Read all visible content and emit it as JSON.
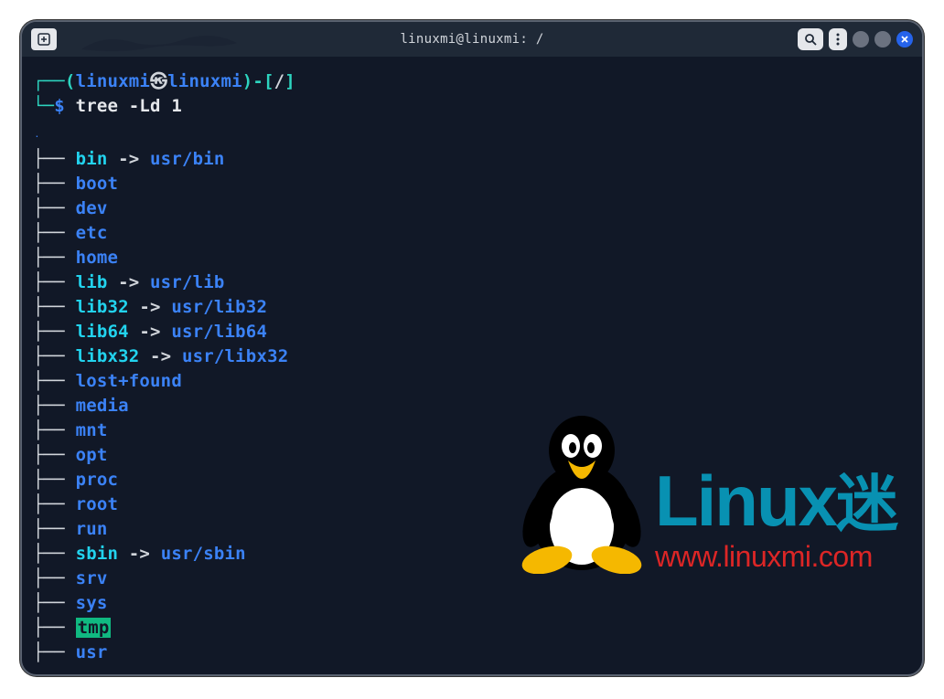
{
  "titlebar": {
    "title": "linuxmi@linuxmi: /",
    "tab_icon": "＋",
    "search_icon": "search",
    "menu_icon": "menu"
  },
  "prompt": {
    "corner_top": "┌──",
    "paren_open": "(",
    "user": "linuxmi",
    "skull": "㉿",
    "host": "linuxmi",
    "paren_close": ")",
    "dash": "-",
    "bracket_open": "[",
    "path": "/",
    "bracket_close": "]",
    "corner_bottom": "└─",
    "dollar": "$",
    "command": "tree -Ld 1"
  },
  "tree": {
    "root_dot": ".",
    "entries": [
      {
        "branch": "├── ",
        "name": "bin",
        "type": "link",
        "arrow": " -> ",
        "target": "usr/bin"
      },
      {
        "branch": "├── ",
        "name": "boot",
        "type": "dir"
      },
      {
        "branch": "├── ",
        "name": "dev",
        "type": "dir"
      },
      {
        "branch": "├── ",
        "name": "etc",
        "type": "dir"
      },
      {
        "branch": "├── ",
        "name": "home",
        "type": "dir"
      },
      {
        "branch": "├── ",
        "name": "lib",
        "type": "link",
        "arrow": " -> ",
        "target": "usr/lib"
      },
      {
        "branch": "├── ",
        "name": "lib32",
        "type": "link",
        "arrow": " -> ",
        "target": "usr/lib32"
      },
      {
        "branch": "├── ",
        "name": "lib64",
        "type": "link",
        "arrow": " -> ",
        "target": "usr/lib64"
      },
      {
        "branch": "├── ",
        "name": "libx32",
        "type": "link",
        "arrow": " -> ",
        "target": "usr/libx32"
      },
      {
        "branch": "├── ",
        "name": "lost+found",
        "type": "dir"
      },
      {
        "branch": "├── ",
        "name": "media",
        "type": "dir"
      },
      {
        "branch": "├── ",
        "name": "mnt",
        "type": "dir"
      },
      {
        "branch": "├── ",
        "name": "opt",
        "type": "dir"
      },
      {
        "branch": "├── ",
        "name": "proc",
        "type": "dir"
      },
      {
        "branch": "├── ",
        "name": "root",
        "type": "dir"
      },
      {
        "branch": "├── ",
        "name": "run",
        "type": "dir"
      },
      {
        "branch": "├── ",
        "name": "sbin",
        "type": "link",
        "arrow": " -> ",
        "target": "usr/sbin"
      },
      {
        "branch": "├── ",
        "name": "srv",
        "type": "dir"
      },
      {
        "branch": "├── ",
        "name": "sys",
        "type": "dir"
      },
      {
        "branch": "├── ",
        "name": "tmp",
        "type": "sticky"
      },
      {
        "branch": "├── ",
        "name": "usr",
        "type": "dir"
      }
    ]
  },
  "watermark": {
    "title_main": "Linux",
    "title_sub": "迷",
    "url": "www.linuxmi.com"
  }
}
